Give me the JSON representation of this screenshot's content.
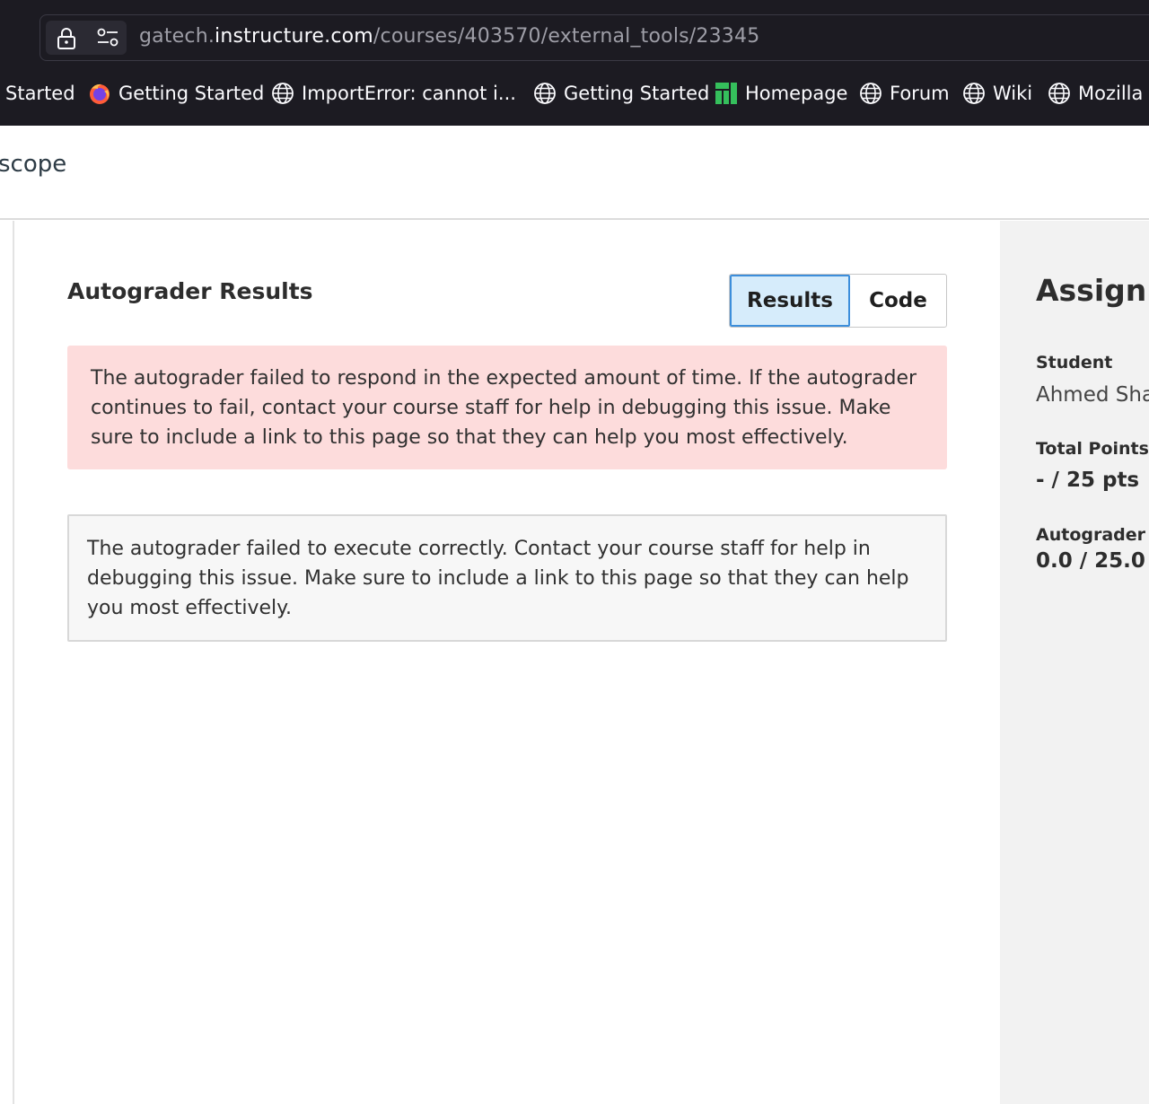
{
  "browser": {
    "url_prefix": "gatech.",
    "url_host": "instructure.com",
    "url_path": "/courses/403570/external_tools/23345"
  },
  "bookmarks": [
    {
      "label": "Started",
      "icon": "none"
    },
    {
      "label": "Getting Started",
      "icon": "firefox-icon"
    },
    {
      "label": "ImportError: cannot i...",
      "icon": "globe-icon"
    },
    {
      "label": "Getting Started",
      "icon": "globe-icon"
    },
    {
      "label": "Homepage",
      "icon": "manjaro-icon"
    },
    {
      "label": "Forum",
      "icon": "globe-icon"
    },
    {
      "label": "Wiki",
      "icon": "globe-icon"
    },
    {
      "label": "Mozilla I",
      "icon": "globe-icon"
    }
  ],
  "header": {
    "title": "scope"
  },
  "main": {
    "title": "Autograder Results",
    "tabs": {
      "results": "Results",
      "code": "Code"
    },
    "error_message": "The autograder failed to respond in the expected amount of time. If the autograder continues to fail, contact your course staff for help in debugging this issue. Make sure to include a link to this page so that they can help you most effectively.",
    "info_message": "The autograder failed to execute correctly. Contact your course staff for help in debugging this issue. Make sure to include a link to this page so that they can help you most effectively."
  },
  "sidebar": {
    "heading": "Assignm",
    "student_label": "Student",
    "student_value": "Ahmed Sha",
    "total_points_label": "Total Points",
    "total_points_value": "- / 25 pts",
    "autograder_label": "Autograder S",
    "autograder_value": "0.0 / 25.0"
  },
  "colors": {
    "chrome_bg": "#1c1b22",
    "error_bg": "#fddcdc",
    "active_tab_bg": "#d6ecfb",
    "active_tab_border": "#3c8edb",
    "sidebar_bg": "#f2f2f2"
  }
}
